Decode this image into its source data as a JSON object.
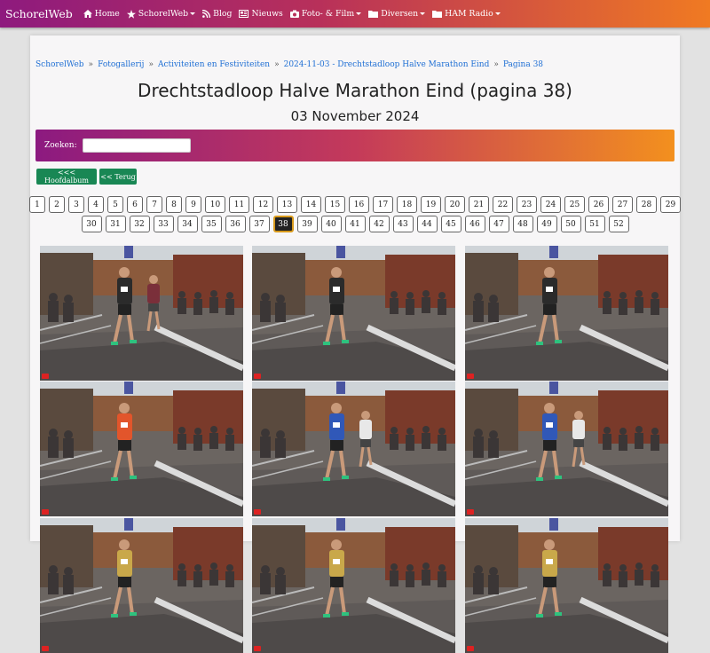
{
  "nav": {
    "brand": "SchorelWeb",
    "items": [
      {
        "label": "Home",
        "icon": "home-icon",
        "dropdown": false
      },
      {
        "label": "SchorelWeb",
        "icon": "star-icon",
        "dropdown": true
      },
      {
        "label": "Blog",
        "icon": "rss-icon",
        "dropdown": false
      },
      {
        "label": "Nieuws",
        "icon": "newspaper-icon",
        "dropdown": false
      },
      {
        "label": "Foto- & Film",
        "icon": "camera-icon",
        "dropdown": true
      },
      {
        "label": "Diversen",
        "icon": "folder-icon",
        "dropdown": true
      },
      {
        "label": "HAM Radio",
        "icon": "folder-icon",
        "dropdown": true
      }
    ]
  },
  "breadcrumb": [
    "SchorelWeb",
    "Fotogallerij",
    "Activiteiten en Festiviteiten",
    "2024-11-03 - Drechtstadloop Halve Marathon Eind",
    "Pagina 38"
  ],
  "page": {
    "title": "Drechtstadloop Halve Marathon Eind (pagina 38)",
    "date": "03 November 2024"
  },
  "search": {
    "label": "Zoeken:",
    "value": ""
  },
  "buttons": {
    "main_album": "<<< Hoofdalbum",
    "back": "<< Terug"
  },
  "pagination": {
    "current": 38,
    "row1": [
      "1",
      "2",
      "3",
      "4",
      "5",
      "6",
      "7",
      "8",
      "9",
      "10",
      "11",
      "12",
      "13",
      "14",
      "15",
      "16",
      "17",
      "18",
      "19",
      "20",
      "21",
      "22",
      "23",
      "24",
      "25",
      "26",
      "27",
      "28",
      "29"
    ],
    "row2": [
      "30",
      "31",
      "32",
      "33",
      "34",
      "35",
      "36",
      "37",
      "38",
      "39",
      "40",
      "41",
      "42",
      "43",
      "44",
      "45",
      "46",
      "47",
      "48",
      "49",
      "50",
      "51",
      "52"
    ]
  },
  "colors": {
    "nav_gradient_start": "#8e1a7e",
    "nav_gradient_end": "#f07a22",
    "link": "#1f6fd4",
    "button_green": "#198754",
    "active_page_border": "#d89a1c"
  },
  "photos": [
    {
      "runner_shirt": "#2b2b2b",
      "second_runner_shirt": "#7a2f3a"
    },
    {
      "runner_shirt": "#2b2b2b",
      "second_runner_shirt": null
    },
    {
      "runner_shirt": "#2b2b2b",
      "second_runner_shirt": null
    },
    {
      "runner_shirt": "#e2552b",
      "second_runner_shirt": null
    },
    {
      "runner_shirt": "#3058b8",
      "second_runner_shirt": "#e8e8e8"
    },
    {
      "runner_shirt": "#3058b8",
      "second_runner_shirt": "#e8e8e8"
    },
    {
      "runner_shirt": "#c9a84a",
      "second_runner_shirt": null
    },
    {
      "runner_shirt": "#c9a84a",
      "second_runner_shirt": null
    },
    {
      "runner_shirt": "#c9a84a",
      "second_runner_shirt": null
    }
  ]
}
